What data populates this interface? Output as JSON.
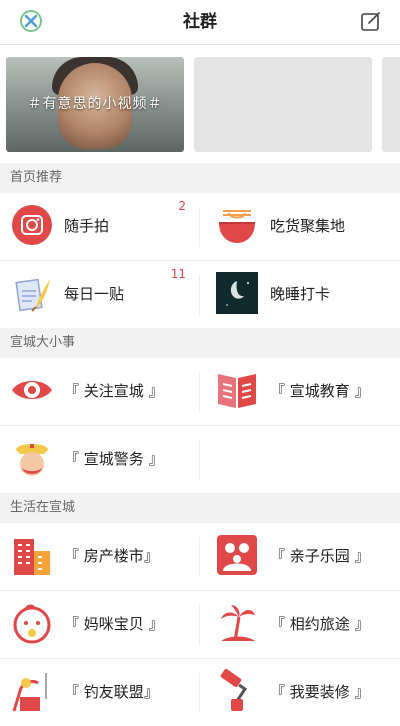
{
  "header": {
    "title": "社群"
  },
  "carousel": {
    "slides": [
      {
        "caption": "＃有意思的小视频＃"
      }
    ]
  },
  "sections": [
    {
      "title": "首页推荐",
      "items": [
        {
          "label": "随手拍",
          "badge": "2",
          "icon": "camera-icon"
        },
        {
          "label": "吃货聚集地",
          "badge": "",
          "icon": "noodle-bowl-icon"
        },
        {
          "label": "每日一贴",
          "badge": "11",
          "icon": "paper-quill-icon"
        },
        {
          "label": "晚睡打卡",
          "badge": "",
          "icon": "night-sky-icon"
        }
      ]
    },
    {
      "title": "宣城大小事",
      "items": [
        {
          "label": "『 关注宣城 』",
          "icon": "eye-icon"
        },
        {
          "label": "『 宣城教育 』",
          "icon": "book-icon"
        },
        {
          "label": "『 宣城警务 』",
          "icon": "police-cap-icon"
        }
      ]
    },
    {
      "title": "生活在宣城",
      "items": [
        {
          "label": "『 房产楼市』",
          "icon": "building-icon"
        },
        {
          "label": "『 亲子乐园 』",
          "icon": "family-icon"
        },
        {
          "label": "『 妈咪宝贝 』",
          "icon": "baby-icon"
        },
        {
          "label": "『 相约旅途 』",
          "icon": "palm-island-icon"
        },
        {
          "label": "『 钓友联盟』",
          "icon": "fishing-icon"
        },
        {
          "label": "『 我要装修 』",
          "icon": "paint-roller-icon"
        }
      ]
    }
  ],
  "colors": {
    "accent": "#e04848",
    "section_bg": "#f2f2f2"
  }
}
